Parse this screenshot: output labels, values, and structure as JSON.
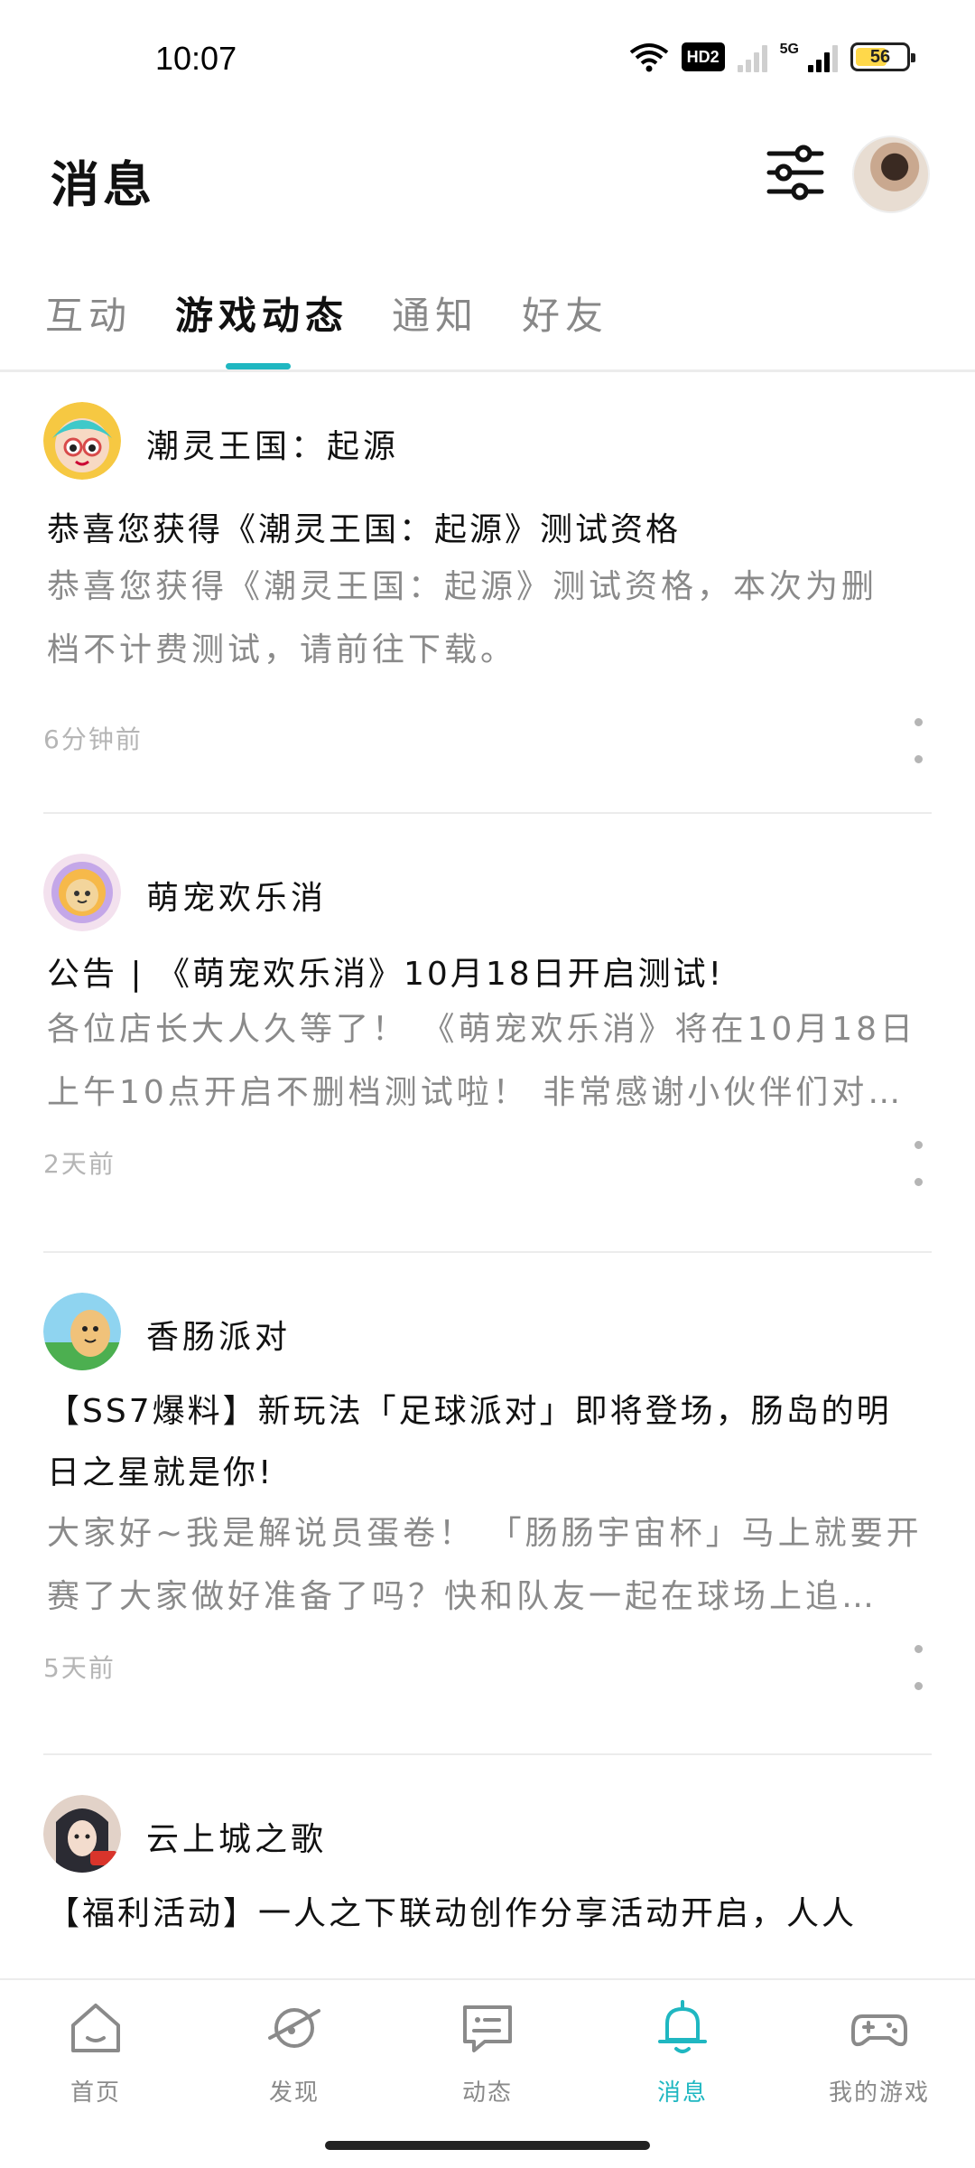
{
  "status_bar": {
    "time": "10:07",
    "hd_label": "HD2",
    "network_label": "5G",
    "battery": "56"
  },
  "header": {
    "title": "消息"
  },
  "tabs": [
    {
      "label": "互动",
      "active": false
    },
    {
      "label": "游戏动态",
      "active": true
    },
    {
      "label": "通知",
      "active": false
    },
    {
      "label": "好友",
      "active": false
    }
  ],
  "feed": [
    {
      "game": "潮灵王国：起源",
      "title": "恭喜您获得《潮灵王国：起源》测试资格",
      "body_lines": [
        "恭喜您获得《潮灵王国：起源》测试资格，本次为删",
        "档不计费测试，请前往下载。"
      ],
      "time": "6分钟前"
    },
    {
      "game": "萌宠欢乐消",
      "title": "公告 | 《萌宠欢乐消》10月18日开启测试!",
      "body_lines": [
        "各位店长大人久等了！ 《萌宠欢乐消》将在10月18日",
        "上午10点开启不删档测试啦！ 非常感谢小伙伴们对…"
      ],
      "time": "2天前"
    },
    {
      "game": "香肠派对",
      "title_lines": [
        "【SS7爆料】新玩法「足球派对」即将登场，肠岛的明",
        "日之星就是你!"
      ],
      "body_lines": [
        "大家好~我是解说员蛋卷！ 「肠肠宇宙杯」马上就要开",
        "赛了大家做好准备了吗？快和队友一起在球场上追…"
      ],
      "time": "5天前"
    },
    {
      "game": "云上城之歌",
      "title": "【福利活动】一人之下联动创作分享活动开启，人人"
    }
  ],
  "bottom_nav": [
    {
      "label": "首页",
      "icon": "home-icon",
      "active": false
    },
    {
      "label": "发现",
      "icon": "planet-icon",
      "active": false
    },
    {
      "label": "动态",
      "icon": "chat-icon",
      "active": false
    },
    {
      "label": "消息",
      "icon": "bell-icon",
      "active": true
    },
    {
      "label": "我的游戏",
      "icon": "gamepad-icon",
      "active": false
    }
  ],
  "colors": {
    "accent": "#1fb7c1",
    "muted_text": "#8a8a8a",
    "time_text": "#b5b5b5"
  }
}
